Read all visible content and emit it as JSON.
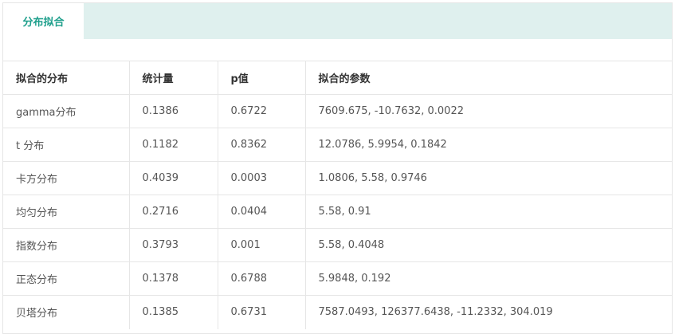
{
  "tabs": {
    "active_label": "分布拟合"
  },
  "table": {
    "headers": [
      "拟合的分布",
      "统计量",
      "p值",
      "拟合的参数"
    ],
    "rows": [
      [
        "gamma分布",
        "0.1386",
        "0.6722",
        "7609.675, -10.7632, 0.0022"
      ],
      [
        "t 分布",
        "0.1182",
        "0.8362",
        "12.0786, 5.9954, 0.1842"
      ],
      [
        "卡方分布",
        "0.4039",
        "0.0003",
        "1.0806, 5.58, 0.9746"
      ],
      [
        "均匀分布",
        "0.2716",
        "0.0404",
        "5.58, 0.91"
      ],
      [
        "指数分布",
        "0.3793",
        "0.001",
        "5.58, 0.4048"
      ],
      [
        "正态分布",
        "0.1378",
        "0.6788",
        "5.9848, 0.192"
      ],
      [
        "贝塔分布",
        "0.1385",
        "0.6731",
        "7587.0493, 126377.6438, -11.2332, 304.019"
      ]
    ]
  },
  "colors": {
    "accent": "#1e9f8c",
    "tabbar_background": "#dff0ee",
    "border": "#e6e6e6"
  }
}
